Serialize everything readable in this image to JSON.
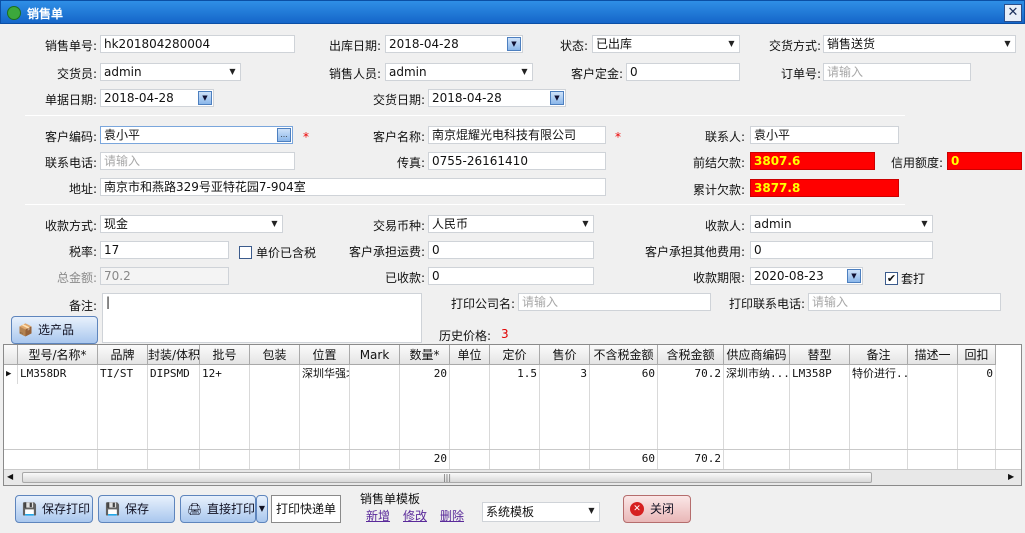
{
  "window": {
    "title": "销售单",
    "close_glyph": "✕"
  },
  "fields": {
    "order_no_label": "销售单号:",
    "order_no": "hk201804280004",
    "out_date_label": "出库日期:",
    "out_date": "2018-04-28",
    "status_label": "状态:",
    "status": "已出库",
    "delivery_method_label": "交货方式:",
    "delivery_method": "销售送货",
    "deliverer_label": "交货员:",
    "deliverer": "admin",
    "salesperson_label": "销售人员:",
    "salesperson": "admin",
    "deposit_label": "客户定金:",
    "deposit": "0",
    "order_num_label": "订单号:",
    "order_num_placeholder": "请输入",
    "doc_date_label": "单据日期:",
    "doc_date": "2018-04-28",
    "delivery_date_label": "交货日期:",
    "delivery_date": "2018-04-28",
    "customer_code_label": "客户编码:",
    "customer_code": "袁小平",
    "required_mark": "*",
    "customer_name_label": "客户名称:",
    "customer_name": "南京焜耀光电科技有限公司",
    "contact_label": "联系人:",
    "contact": "袁小平",
    "phone_label": "联系电话:",
    "phone_placeholder": "请输入",
    "fax_label": "传真:",
    "fax": "0755-26161410",
    "prev_debt_label": "前结欠款:",
    "prev_debt": "3807.6",
    "credit_label": "信用额度:",
    "credit": "0",
    "address_label": "地址:",
    "address": "南京市和燕路329号亚特花园7-904室",
    "total_debt_label": "累计欠款:",
    "total_debt": "3877.8",
    "payment_method_label": "收款方式:",
    "payment_method": "现金",
    "currency_label": "交易币种:",
    "currency": "人民币",
    "payee_label": "收款人:",
    "payee": "admin",
    "tax_rate_label": "税率:",
    "tax_rate": "17",
    "price_incl_tax_label": "单价已含税",
    "freight_label": "客户承担运费:",
    "freight": "0",
    "other_fees_label": "客户承担其他费用:",
    "other_fees": "0",
    "total_label": "总金额:",
    "total": "70.2",
    "received_label": "已收款:",
    "received": "0",
    "due_date_label": "收款期限:",
    "due_date": "2020-08-23",
    "set_print_label": "套打",
    "set_print_checked": "✔",
    "remark_label": "备注:",
    "remark": "|",
    "select_products_button": "选产品",
    "print_company_label": "打印公司名:",
    "print_company_placeholder": "请输入",
    "print_phone_label": "打印联系电话:",
    "print_phone_placeholder": "请输入",
    "history_price_label": "历史价格:",
    "history_price": "3"
  },
  "grid": {
    "columns": [
      "型号/名称*",
      "品牌",
      "封装/体积",
      "批号",
      "包装",
      "位置",
      "Mark",
      "数量*",
      "单位",
      "定价",
      "售价",
      "不含税金额",
      "含税金额",
      "供应商编码",
      "替型",
      "备注",
      "描述一",
      "回扣"
    ],
    "rows": [
      {
        "indicator": "▶",
        "cells": [
          "LM358DR",
          "TI/ST",
          "DIPSMD",
          "12+",
          "",
          "深圳华强北...",
          "",
          "20",
          "",
          "1.5",
          "3",
          "60",
          "70.2",
          "深圳市纳...",
          "LM358P",
          "特价进行...",
          "",
          "0"
        ]
      }
    ],
    "totals": [
      "",
      "",
      "",
      "",
      "",
      "",
      "",
      "20",
      "",
      "",
      "",
      "60",
      "70.2",
      "",
      "",
      "",
      "",
      ""
    ],
    "scroll_mark": "|||"
  },
  "toolbar": {
    "save_print": "保存打印",
    "save": "保存",
    "direct_print": "直接打印",
    "print_express": "打印快递单",
    "template_label": "销售单模板",
    "template_new": "新增",
    "template_edit": "修改",
    "template_delete": "删除",
    "template_select": "系统模板",
    "close": "关闭"
  },
  "colors": {
    "title_bar": "#1a6fd4",
    "alert_bg": "#ff0000",
    "alert_text": "#ffff00",
    "history_price": "#e00000"
  }
}
